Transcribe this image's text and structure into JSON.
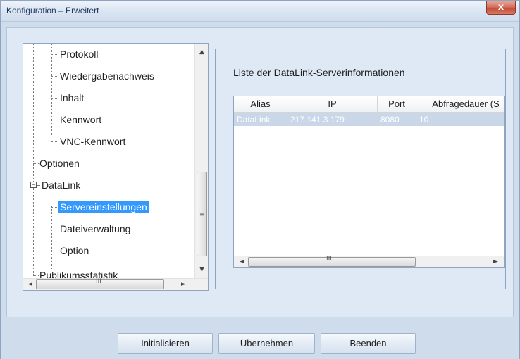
{
  "window": {
    "title": "Konfiguration – Erweitert",
    "close_label": "x"
  },
  "tree": {
    "items": [
      {
        "label": "Protokoll",
        "level": 2
      },
      {
        "label": "Wiedergabenachweis",
        "level": 2
      },
      {
        "label": "Inhalt",
        "level": 2
      },
      {
        "label": "Kennwort",
        "level": 2
      },
      {
        "label": "VNC-Kennwort",
        "level": 2
      },
      {
        "label": "Optionen",
        "level": 1
      },
      {
        "label": "DataLink",
        "level": 1,
        "expander": "−"
      },
      {
        "label": "Servereinstellungen",
        "level": 2,
        "selected": true
      },
      {
        "label": "Dateiverwaltung",
        "level": 2
      },
      {
        "label": "Option",
        "level": 2
      },
      {
        "label": "Publikumsstatistik",
        "level": 1
      }
    ],
    "scroll_up_icon": "▲",
    "scroll_down_icon": "▼",
    "scroll_left_icon": "◄",
    "scroll_right_icon": "►",
    "grip": "≡",
    "hgrip": "III"
  },
  "server_list": {
    "title": "Liste der DataLink-Serverinformationen",
    "columns": [
      "Alias",
      "IP",
      "Port",
      "Abfragedauer (S"
    ],
    "rows": [
      {
        "alias": "DataLink",
        "ip": "217.141.3.179",
        "port": "8080",
        "duration": "10"
      }
    ],
    "scroll_left_icon": "◄",
    "scroll_right_icon": "►",
    "hgrip": "III"
  },
  "buttons": {
    "initialize": "Initialisieren",
    "apply": "Übernehmen",
    "exit": "Beenden"
  },
  "colors": {
    "selection": "#3399ff",
    "panel_bg": "#dfe9f5",
    "window_bg": "#cfdcec"
  }
}
